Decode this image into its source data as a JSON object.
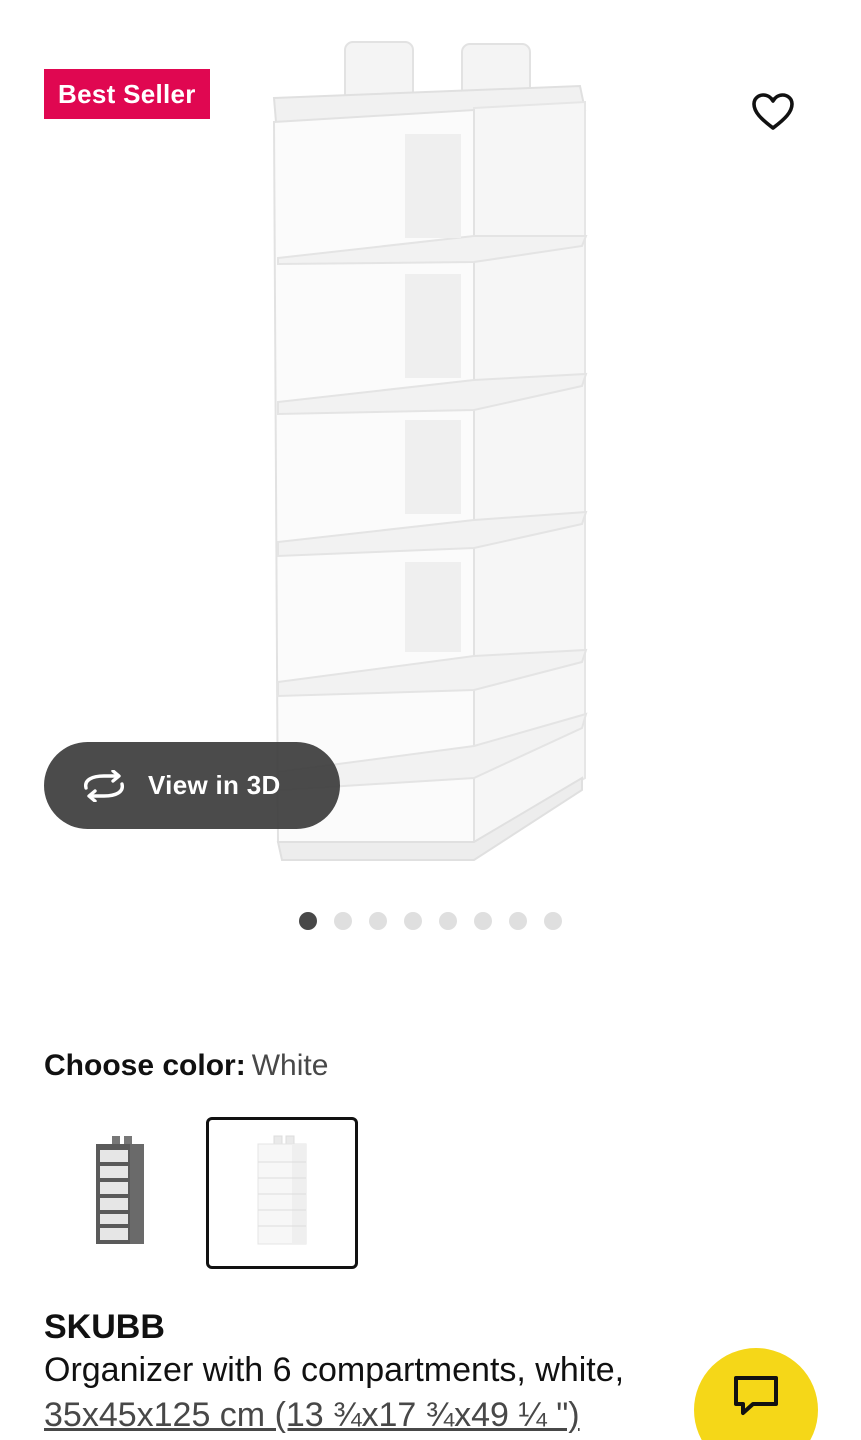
{
  "gallery": {
    "badge": "Best Seller",
    "view3d_label": "View in 3D",
    "dots_total": 8,
    "dots_active_index": 0
  },
  "icons": {
    "favorite": "heart-icon",
    "view3d": "rotate-3d-icon",
    "chat": "chat-bubble-icon"
  },
  "color_picker": {
    "heading": "Choose color:",
    "selected": "White",
    "options": [
      "Dark gray",
      "White"
    ]
  },
  "product": {
    "name": "SKUBB",
    "description": "Organizer with 6 compartments, white,",
    "measurements": "35x45x125 cm (13 ¾x17 ¾x49 ¼ \")"
  },
  "colors": {
    "badge_bg": "#e00751",
    "chat_button_bg": "#f5d718",
    "view3d_bg": "#3c3c3c",
    "dot_active": "#484848",
    "dot_inactive": "#dfdfdf"
  }
}
